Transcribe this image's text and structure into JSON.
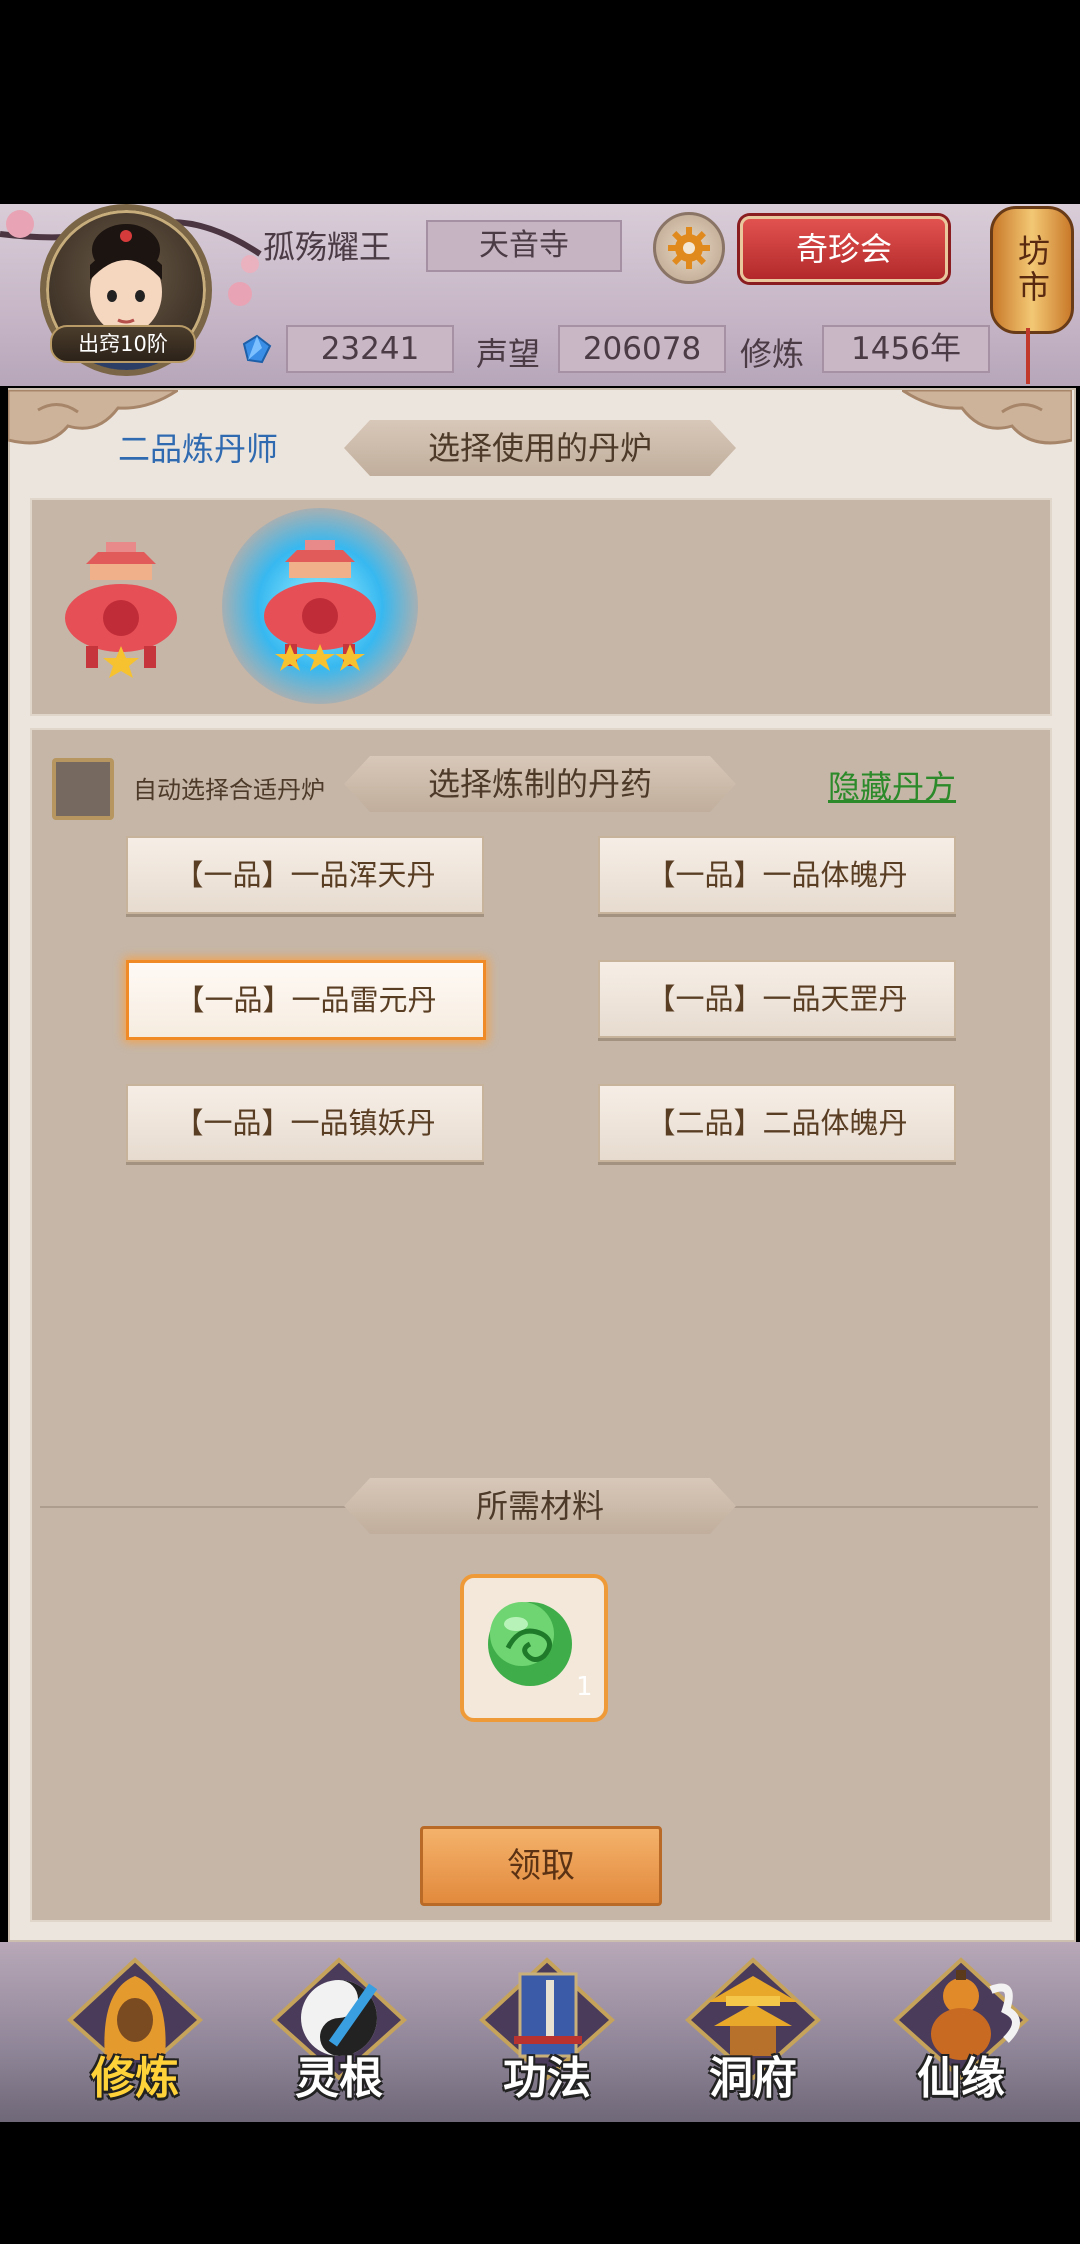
{
  "player": {
    "name": "孤殇耀王",
    "rank_badge": "出窍10阶",
    "sect": "天音寺"
  },
  "header": {
    "treasure_button": "奇珍会",
    "market_label": "坊市",
    "stones": "23241",
    "reputation_label": "声望",
    "reputation": "206078",
    "cultivation_label": "修炼",
    "cultivation": "1456年"
  },
  "panel": {
    "rank_title": "二品炼丹师",
    "furnace_section": "选择使用的丹炉",
    "pill_section": "选择炼制的丹药",
    "auto_select_label": "自动选择合适丹炉",
    "hide_recipe_link": "隐藏丹方",
    "materials_section": "所需材料",
    "material_count": "1",
    "claim_button": "领取"
  },
  "furnaces": [
    {
      "stars": 1,
      "selected": false
    },
    {
      "stars": 3,
      "selected": true
    }
  ],
  "pills": [
    {
      "label": "【一品】一品浑天丹",
      "selected": false
    },
    {
      "label": "【一品】一品体魄丹",
      "selected": false
    },
    {
      "label": "【一品】一品雷元丹",
      "selected": true
    },
    {
      "label": "【一品】一品天罡丹",
      "selected": false
    },
    {
      "label": "【一品】一品镇妖丹",
      "selected": false
    },
    {
      "label": "【二品】二品体魄丹",
      "selected": false
    }
  ],
  "nav": [
    {
      "label": "修炼",
      "icon": "hooded-monk-icon",
      "active": true
    },
    {
      "label": "灵根",
      "icon": "yin-yang-sword-icon",
      "active": false
    },
    {
      "label": "功法",
      "icon": "book-icon",
      "active": false
    },
    {
      "label": "洞府",
      "icon": "pagoda-icon",
      "active": false
    },
    {
      "label": "仙缘",
      "icon": "gourd-icon",
      "active": false
    }
  ],
  "colors": {
    "accent_orange": "#f08a27",
    "link_green": "#2c8a2a",
    "title_blue": "#2f6ab0",
    "treasure_red": "#c93a3a"
  }
}
